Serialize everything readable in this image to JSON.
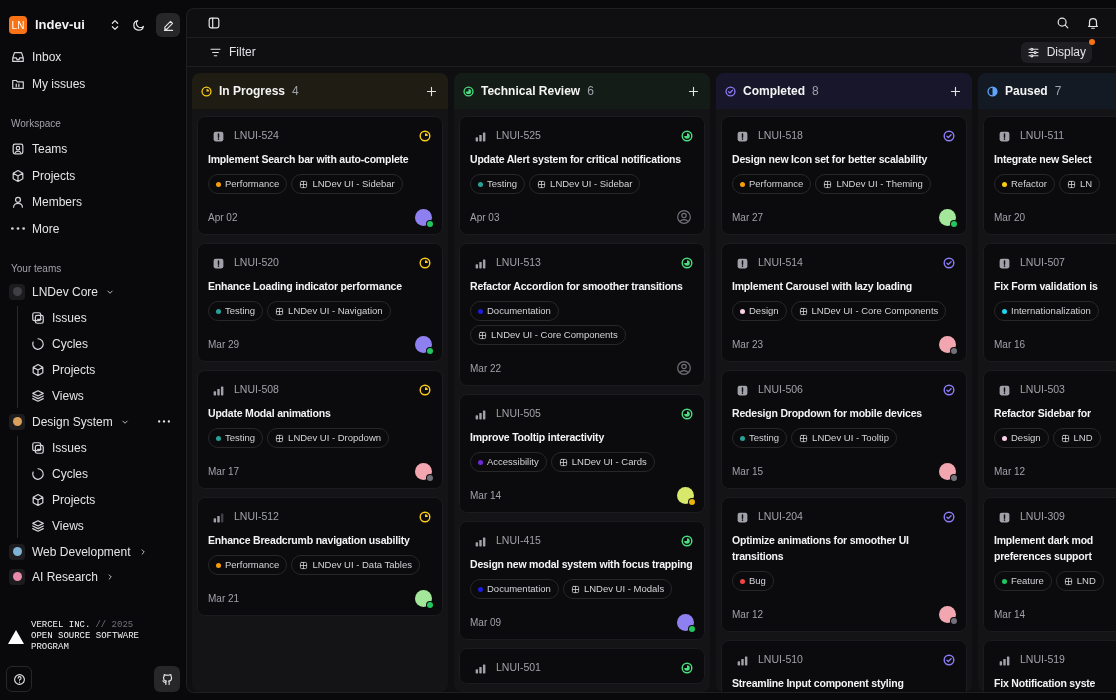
{
  "workspace": {
    "initials": "LN",
    "name": "lndev-ui"
  },
  "sidebar": {
    "nav": [
      {
        "label": "Inbox"
      },
      {
        "label": "My issues"
      }
    ],
    "workspace_label": "Workspace",
    "workspace_items": [
      {
        "label": "Teams"
      },
      {
        "label": "Projects"
      },
      {
        "label": "Members"
      },
      {
        "label": "More"
      }
    ],
    "teams_label": "Your teams",
    "teams": [
      {
        "name": "LNDev Core",
        "expanded": true,
        "hovered": false,
        "color": "#3f3f46",
        "children": [
          {
            "label": "Issues"
          },
          {
            "label": "Cycles"
          },
          {
            "label": "Projects"
          },
          {
            "label": "Views"
          }
        ]
      },
      {
        "name": "Design System",
        "expanded": true,
        "hovered": true,
        "color": "#d9a05b",
        "children": [
          {
            "label": "Issues"
          },
          {
            "label": "Cycles"
          },
          {
            "label": "Projects"
          },
          {
            "label": "Views"
          }
        ]
      },
      {
        "name": "Web Development",
        "expanded": false,
        "hovered": false,
        "color": "#7fb3d5"
      },
      {
        "name": "AI Research",
        "expanded": false,
        "hovered": false,
        "color": "#e88aa8"
      }
    ]
  },
  "footer": {
    "company": "VERCEL INC.",
    "year": "// 2025",
    "program": "OPEN SOURCE SOFTWARE PROGRAM"
  },
  "toolbar": {
    "filter": "Filter",
    "display": "Display",
    "display_badge": true
  },
  "columns": [
    {
      "kind": "in_progress",
      "title": "In Progress",
      "count": "4",
      "cards": [
        {
          "id": "LNUI-524",
          "priority": {
            "kind": "urgent"
          },
          "title": "Implement Search bar with auto-complete",
          "labels": [
            {
              "text": "Performance",
              "color": "#f59e0b"
            }
          ],
          "project": "LNDev UI - Sidebar",
          "date": "Apr 02",
          "assignee": {
            "kind": "person",
            "color": "#8f80f2",
            "presence": {
              "color": "#22c55e"
            }
          }
        },
        {
          "id": "LNUI-520",
          "priority": {
            "kind": "urgent"
          },
          "title": "Enhance Loading indicator performance",
          "labels": [
            {
              "text": "Testing",
              "color": "#2aa198"
            }
          ],
          "project": "LNDev UI - Navigation",
          "date": "Mar 29",
          "assignee": {
            "kind": "person",
            "color": "#8f80f2",
            "presence": {
              "color": "#22c55e"
            }
          }
        },
        {
          "id": "LNUI-508",
          "priority": {
            "kind": "high"
          },
          "title": "Update Modal animations",
          "labels": [
            {
              "text": "Testing",
              "color": "#2aa198"
            }
          ],
          "project": "LNDev UI - Dropdown",
          "date": "Mar 17",
          "assignee": {
            "kind": "person",
            "color": "#f2a7b0",
            "presence": {
              "color": "#71717a"
            }
          }
        },
        {
          "id": "LNUI-512",
          "priority": {
            "kind": "medium"
          },
          "title": "Enhance Breadcrumb navigation usability",
          "labels": [
            {
              "text": "Performance",
              "color": "#f59e0b"
            }
          ],
          "project": "LNDev UI - Data Tables",
          "date": "Mar 21",
          "assignee": {
            "kind": "person",
            "color": "#a3e89a",
            "presence": {
              "color": "#22c55e"
            }
          }
        }
      ]
    },
    {
      "kind": "review",
      "title": "Technical Review",
      "count": "6",
      "cards": [
        {
          "id": "LNUI-525",
          "priority": {
            "kind": "high"
          },
          "title": "Update Alert system for critical notifications",
          "labels": [
            {
              "text": "Testing",
              "color": "#2aa198"
            }
          ],
          "project": "LNDev UI - Sidebar",
          "date": "Apr 03",
          "assignee": {
            "kind": "unassigned"
          }
        },
        {
          "id": "LNUI-513",
          "priority": {
            "kind": "high"
          },
          "title": "Refactor Accordion for smoother transitions",
          "labels": [
            {
              "text": "Documentation",
              "color": "#1d1dd8"
            }
          ],
          "project": "LNDev UI - Core Components",
          "date": "Mar 22",
          "assignee": {
            "kind": "unassigned"
          }
        },
        {
          "id": "LNUI-505",
          "priority": {
            "kind": "high"
          },
          "title": "Improve Tooltip interactivity",
          "labels": [
            {
              "text": "Accessibility",
              "color": "#6d28d9"
            }
          ],
          "project": "LNDev UI - Cards",
          "date": "Mar 14",
          "assignee": {
            "kind": "person",
            "color": "#d8e86a",
            "presence": {
              "color": "#eab308"
            }
          }
        },
        {
          "id": "LNUI-415",
          "priority": {
            "kind": "high"
          },
          "title": "Design new modal system with focus trapping",
          "labels": [
            {
              "text": "Documentation",
              "color": "#1d1dd8"
            }
          ],
          "project": "LNDev UI - Modals",
          "date": "Mar 09",
          "assignee": {
            "kind": "person",
            "color": "#8f80f2",
            "presence": {
              "color": "#22c55e"
            }
          }
        },
        {
          "id": "LNUI-501",
          "priority": {
            "kind": "high"
          }
        }
      ]
    },
    {
      "kind": "completed",
      "title": "Completed",
      "count": "8",
      "cards": [
        {
          "id": "LNUI-518",
          "priority": {
            "kind": "urgent"
          },
          "title": "Design new Icon set for better scalability",
          "labels": [
            {
              "text": "Performance",
              "color": "#f59e0b"
            }
          ],
          "project": "LNDev UI - Theming",
          "date": "Mar 27",
          "assignee": {
            "kind": "person",
            "color": "#a3e89a",
            "presence": {
              "color": "#22c55e"
            }
          }
        },
        {
          "id": "LNUI-514",
          "priority": {
            "kind": "urgent"
          },
          "title": "Implement Carousel with lazy loading",
          "labels": [
            {
              "text": "Design",
              "color": "#fbcfe8"
            }
          ],
          "project": "LNDev UI - Core Components",
          "date": "Mar 23",
          "assignee": {
            "kind": "person",
            "color": "#f2a7b0",
            "presence": {
              "color": "#71717a"
            }
          }
        },
        {
          "id": "LNUI-506",
          "priority": {
            "kind": "urgent"
          },
          "title": "Redesign Dropdown for mobile devices",
          "labels": [
            {
              "text": "Testing",
              "color": "#2aa198"
            }
          ],
          "project": "LNDev UI - Tooltip",
          "date": "Mar 15",
          "assignee": {
            "kind": "person",
            "color": "#f2a7b0",
            "presence": {
              "color": "#71717a"
            }
          }
        },
        {
          "id": "LNUI-204",
          "priority": {
            "kind": "urgent"
          },
          "title": "Optimize animations for smoother UI transitions",
          "labels": [
            {
              "text": "Bug",
              "color": "#ef4444"
            }
          ],
          "date": "Mar 12",
          "assignee": {
            "kind": "person",
            "color": "#f2a7b0",
            "presence": {
              "color": "#71717a"
            }
          }
        },
        {
          "id": "LNUI-510",
          "priority": {
            "kind": "high"
          },
          "title": "Streamline Input component styling"
        }
      ]
    },
    {
      "kind": "paused",
      "title": "Paused",
      "count": "7",
      "cards": [
        {
          "id": "LNUI-511",
          "priority": {
            "kind": "urgent"
          },
          "title": "Integrate new Select",
          "labels": [
            {
              "text": "Refactor",
              "color": "#facc15"
            }
          ],
          "project": "LN",
          "date": "Mar 20"
        },
        {
          "id": "LNUI-507",
          "priority": {
            "kind": "urgent"
          },
          "title": "Fix Form validation is",
          "labels": [
            {
              "text": "Internationalization",
              "color": "#22d3ee"
            }
          ],
          "date": "Mar 16"
        },
        {
          "id": "LNUI-503",
          "priority": {
            "kind": "urgent"
          },
          "title": "Refactor Sidebar for",
          "labels": [
            {
              "text": "Design",
              "color": "#fbcfe8"
            }
          ],
          "project": "LND",
          "date": "Mar 12"
        },
        {
          "id": "LNUI-309",
          "priority": {
            "kind": "urgent"
          },
          "title": "Implement dark mod\npreferences support",
          "labels": [
            {
              "text": "Feature",
              "color": "#22c55e"
            }
          ],
          "project": "LND",
          "date": "Mar 14"
        },
        {
          "id": "LNUI-519",
          "priority": {
            "kind": "high"
          },
          "title": "Fix Notification syste"
        }
      ]
    }
  ]
}
